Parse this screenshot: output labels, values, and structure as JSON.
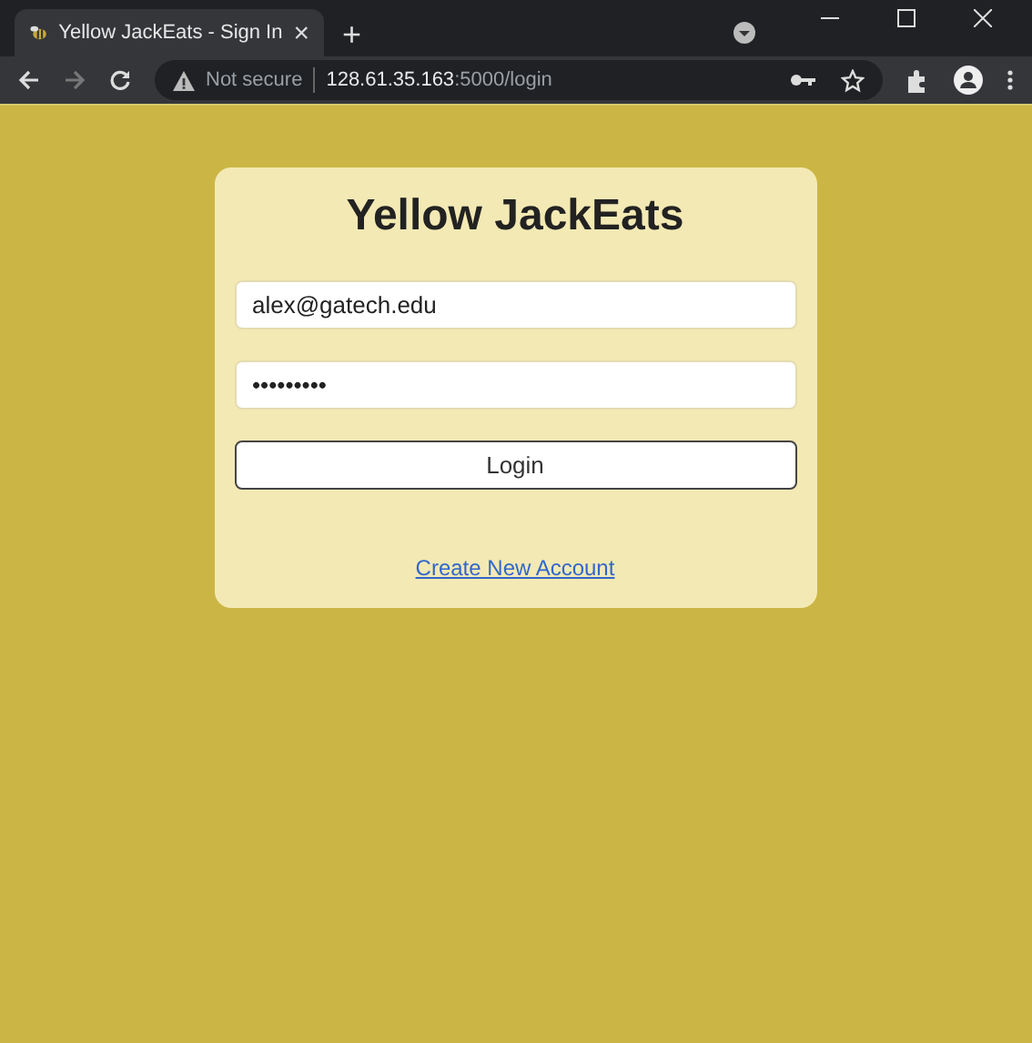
{
  "browser": {
    "tab": {
      "title": "Yellow JackEats - Sign In",
      "close": "×",
      "selected": true
    },
    "new_tab": "+",
    "address": {
      "security": "Not secure",
      "host": "128.61.35.163",
      "path": ":5000/login"
    }
  },
  "login_card": {
    "title": "Yellow JackEats",
    "email": {
      "value": "alex@gatech.edu"
    },
    "password": {
      "value": "•••••••••"
    },
    "button": "Login",
    "link": "Create New Account"
  }
}
